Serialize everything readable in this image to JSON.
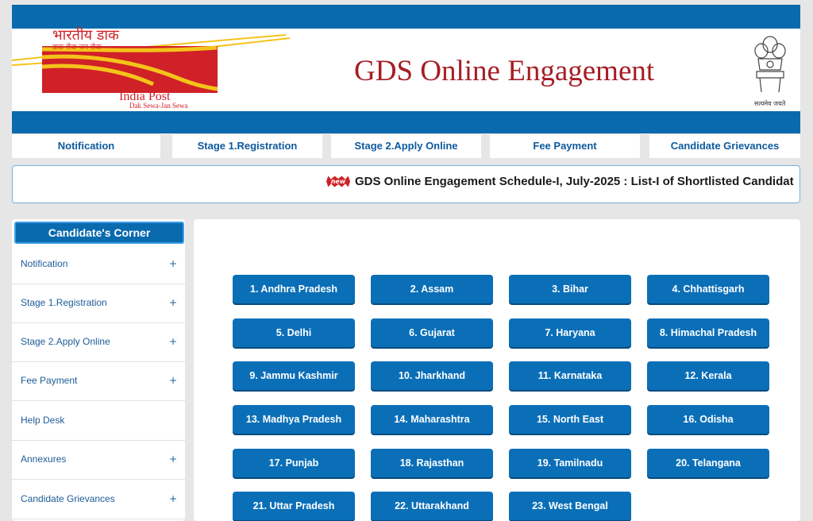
{
  "header": {
    "logo": {
      "hindi": "भारतीय डाक",
      "hindi_sub": "डाक सेवा-जन सेवा",
      "name": "India Post",
      "tagline": "Dak Sewa-Jan Sewa"
    },
    "title": "GDS Online Engagement",
    "emblem_motto": "सत्यमेव जयते",
    "brand_blue": "#0a6aae",
    "brand_red": "#cf2127"
  },
  "topnav": [
    {
      "label": "Notification"
    },
    {
      "label": "Stage 1.Registration"
    },
    {
      "label": "Stage 2.Apply Online"
    },
    {
      "label": "Fee Payment"
    },
    {
      "label": "Candidate Grievances"
    }
  ],
  "marquee": {
    "badge": "new",
    "text": "GDS Online Engagement Schedule-I, July-2025 : List-I of Shortlisted Candidat"
  },
  "sidebar": {
    "title": "Candidate's Corner",
    "items": [
      {
        "label": "Notification",
        "expand": "+"
      },
      {
        "label": "Stage 1.Registration",
        "expand": "+"
      },
      {
        "label": "Stage 2.Apply Online",
        "expand": "+"
      },
      {
        "label": "Fee Payment",
        "expand": "+"
      },
      {
        "label": "Help Desk",
        "expand": ""
      },
      {
        "label": "Annexures",
        "expand": "+"
      },
      {
        "label": "Candidate Grievances",
        "expand": "+"
      }
    ]
  },
  "states": [
    "1. Andhra Pradesh",
    "2. Assam",
    "3. Bihar",
    "4. Chhattisgarh",
    "5. Delhi",
    "6. Gujarat",
    "7. Haryana",
    "8. Himachal Pradesh",
    "9. Jammu Kashmir",
    "10. Jharkhand",
    "11. Karnataka",
    "12. Kerala",
    "13. Madhya Pradesh",
    "14. Maharashtra",
    "15. North East",
    "16. Odisha",
    "17. Punjab",
    "18. Rajasthan",
    "19. Tamilnadu",
    "20. Telangana",
    "21. Uttar Pradesh",
    "22. Uttarakhand",
    "23. West Bengal"
  ]
}
